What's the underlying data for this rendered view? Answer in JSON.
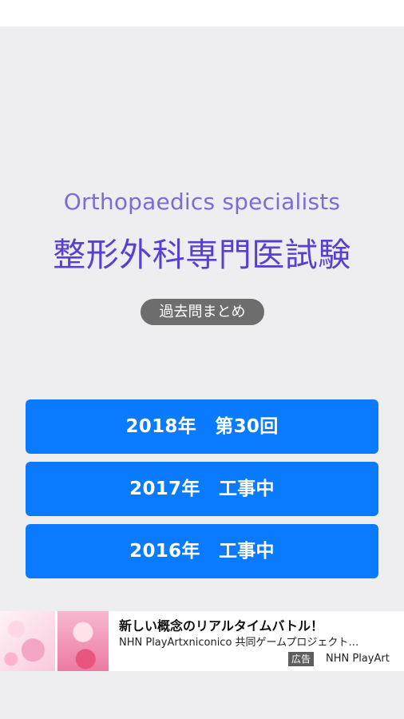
{
  "header": {
    "subtitle": "Orthopaedics specialists",
    "title": "整形外科専門医試験"
  },
  "badge": {
    "label": "過去問まとめ"
  },
  "years": [
    {
      "label": "2018年　第30回"
    },
    {
      "label": "2017年　工事中"
    },
    {
      "label": "2016年　工事中"
    }
  ],
  "ad": {
    "title": "新しい概念のリアルタイムバトル！",
    "description": "NHN PlayArtxniconico 共同ゲームプロジェクト…",
    "tag": "広告",
    "advertiser": "NHN PlayArt"
  },
  "colors": {
    "accent": "#0a7bff",
    "title": "#5b3fd0",
    "subtitle": "#7d6bd6"
  }
}
